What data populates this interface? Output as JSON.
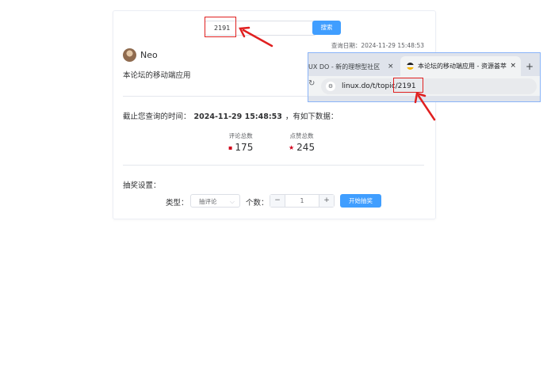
{
  "search": {
    "topic_id": "2191",
    "button_label": "搜索"
  },
  "query_date": "查询日期：2024-11-29 15:48:53",
  "user": {
    "name": "Neo"
  },
  "topic_title": "本论坛的移动端应用",
  "stats": {
    "prefix": "截止您查询的时间：",
    "time": "2024-11-29 15:48:53",
    "suffix": "，有如下数据：",
    "comments_label": "评论总数",
    "comments_value": "175",
    "likes_label": "点赞总数",
    "likes_value": "245"
  },
  "lottery": {
    "title": "抽奖设置：",
    "type_label": "类型：",
    "type_value": "抽评论",
    "count_label": "个数：",
    "count_value": "1",
    "minus": "−",
    "plus": "+",
    "start_label": "开始抽奖"
  },
  "browser": {
    "tab1_label": "UX DO - 新的理想型社区",
    "tab2_label": "本论坛的移动端应用 - 资源荟萃",
    "close": "×",
    "new_tab": "+",
    "url": "linux.do/t/topic/2191"
  },
  "colors": {
    "accent": "#409eff",
    "annotation": "#e02020"
  }
}
